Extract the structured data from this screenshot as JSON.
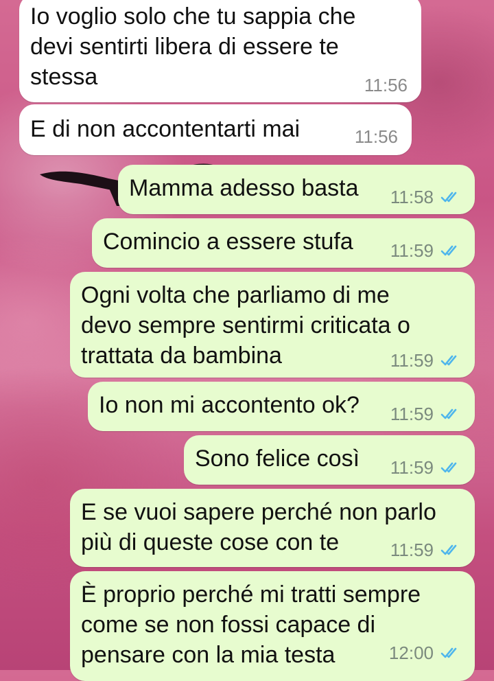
{
  "theme": {
    "incoming_bubble": "#ffffff",
    "outgoing_bubble": "#e7fccf",
    "read_tick": "#4fb6ec"
  },
  "messages": [
    {
      "direction": "in",
      "text": "Io voglio solo che tu sappia che\ndevi sentirti libera di essere te\nstessa",
      "time": "11:56"
    },
    {
      "direction": "in",
      "text": "E di non accontentarti mai",
      "time": "11:56"
    },
    {
      "direction": "out",
      "text": "Mamma adesso basta",
      "time": "11:58",
      "status": "read"
    },
    {
      "direction": "out",
      "text": "Comincio a essere stufa",
      "time": "11:59",
      "status": "read"
    },
    {
      "direction": "out",
      "text": "Ogni volta che parliamo di me\ndevo sempre sentirmi criticata o\ntrattata da bambina",
      "time": "11:59",
      "status": "read"
    },
    {
      "direction": "out",
      "text": "Io non mi accontento ok?",
      "time": "11:59",
      "status": "read"
    },
    {
      "direction": "out",
      "text": "Sono felice così",
      "time": "11:59",
      "status": "read"
    },
    {
      "direction": "out",
      "text": "E se vuoi sapere perché non parlo\npiù di queste cose con te",
      "time": "11:59",
      "status": "read"
    },
    {
      "direction": "out",
      "text": "È proprio perché mi tratti sempre\ncome se non fossi capace di\npensare con la mia testa",
      "time": "12:00",
      "status": "read"
    }
  ]
}
